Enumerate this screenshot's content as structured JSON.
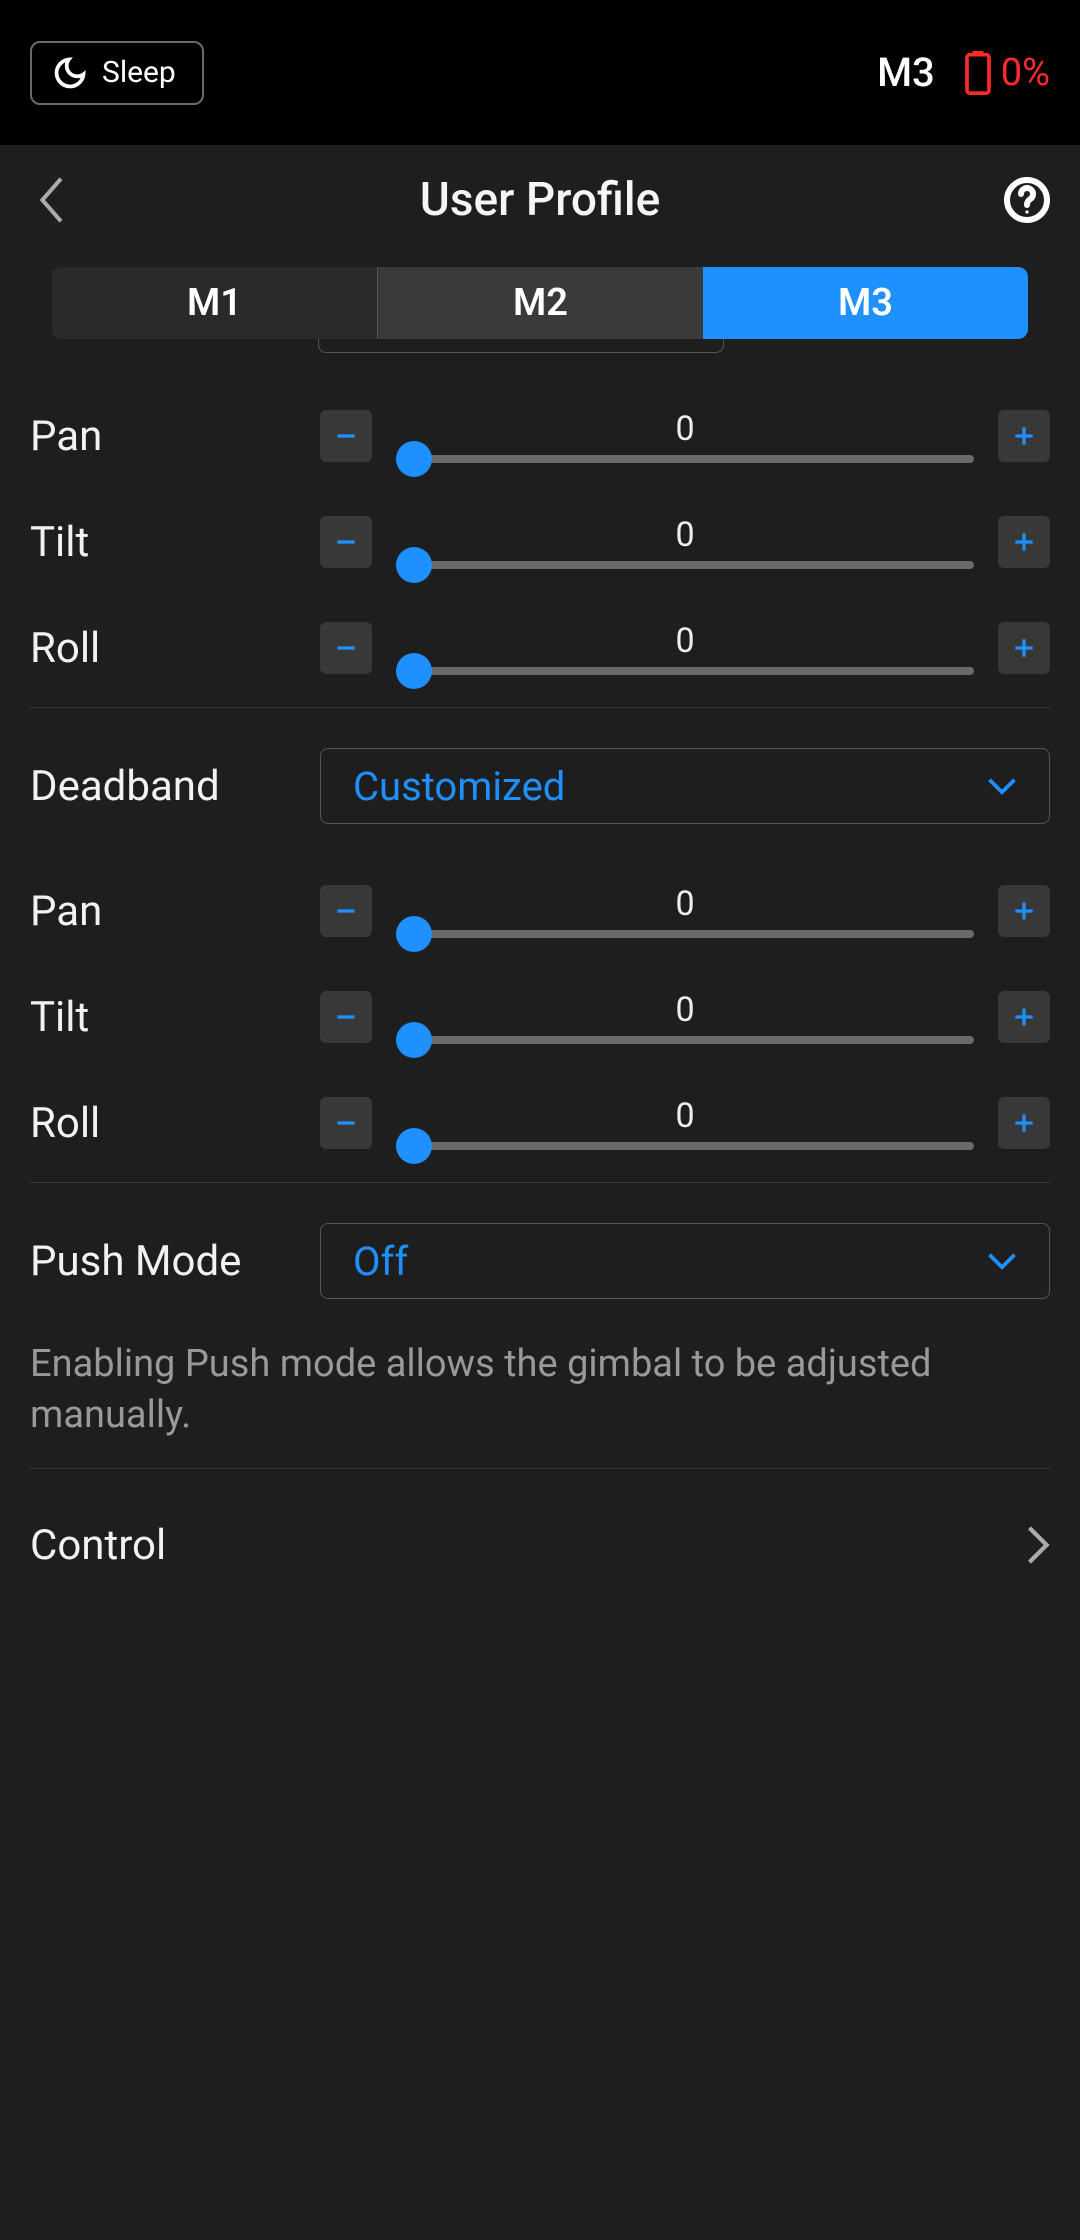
{
  "status": {
    "sleep_label": "Sleep",
    "mode": "M3",
    "battery_pct": "0%"
  },
  "header": {
    "title": "User Profile"
  },
  "tabs": [
    "M1",
    "M2",
    "M3"
  ],
  "active_tab": "M3",
  "group1": {
    "pan": {
      "label": "Pan",
      "value": "0"
    },
    "tilt": {
      "label": "Tilt",
      "value": "0"
    },
    "roll": {
      "label": "Roll",
      "value": "0"
    }
  },
  "deadband": {
    "label": "Deadband",
    "value": "Customized"
  },
  "group2": {
    "pan": {
      "label": "Pan",
      "value": "0"
    },
    "tilt": {
      "label": "Tilt",
      "value": "0"
    },
    "roll": {
      "label": "Roll",
      "value": "0"
    }
  },
  "push_mode": {
    "label": "Push Mode",
    "value": "Off",
    "help": "Enabling Push mode allows the gimbal to be adjusted manually."
  },
  "control": {
    "label": "Control"
  }
}
